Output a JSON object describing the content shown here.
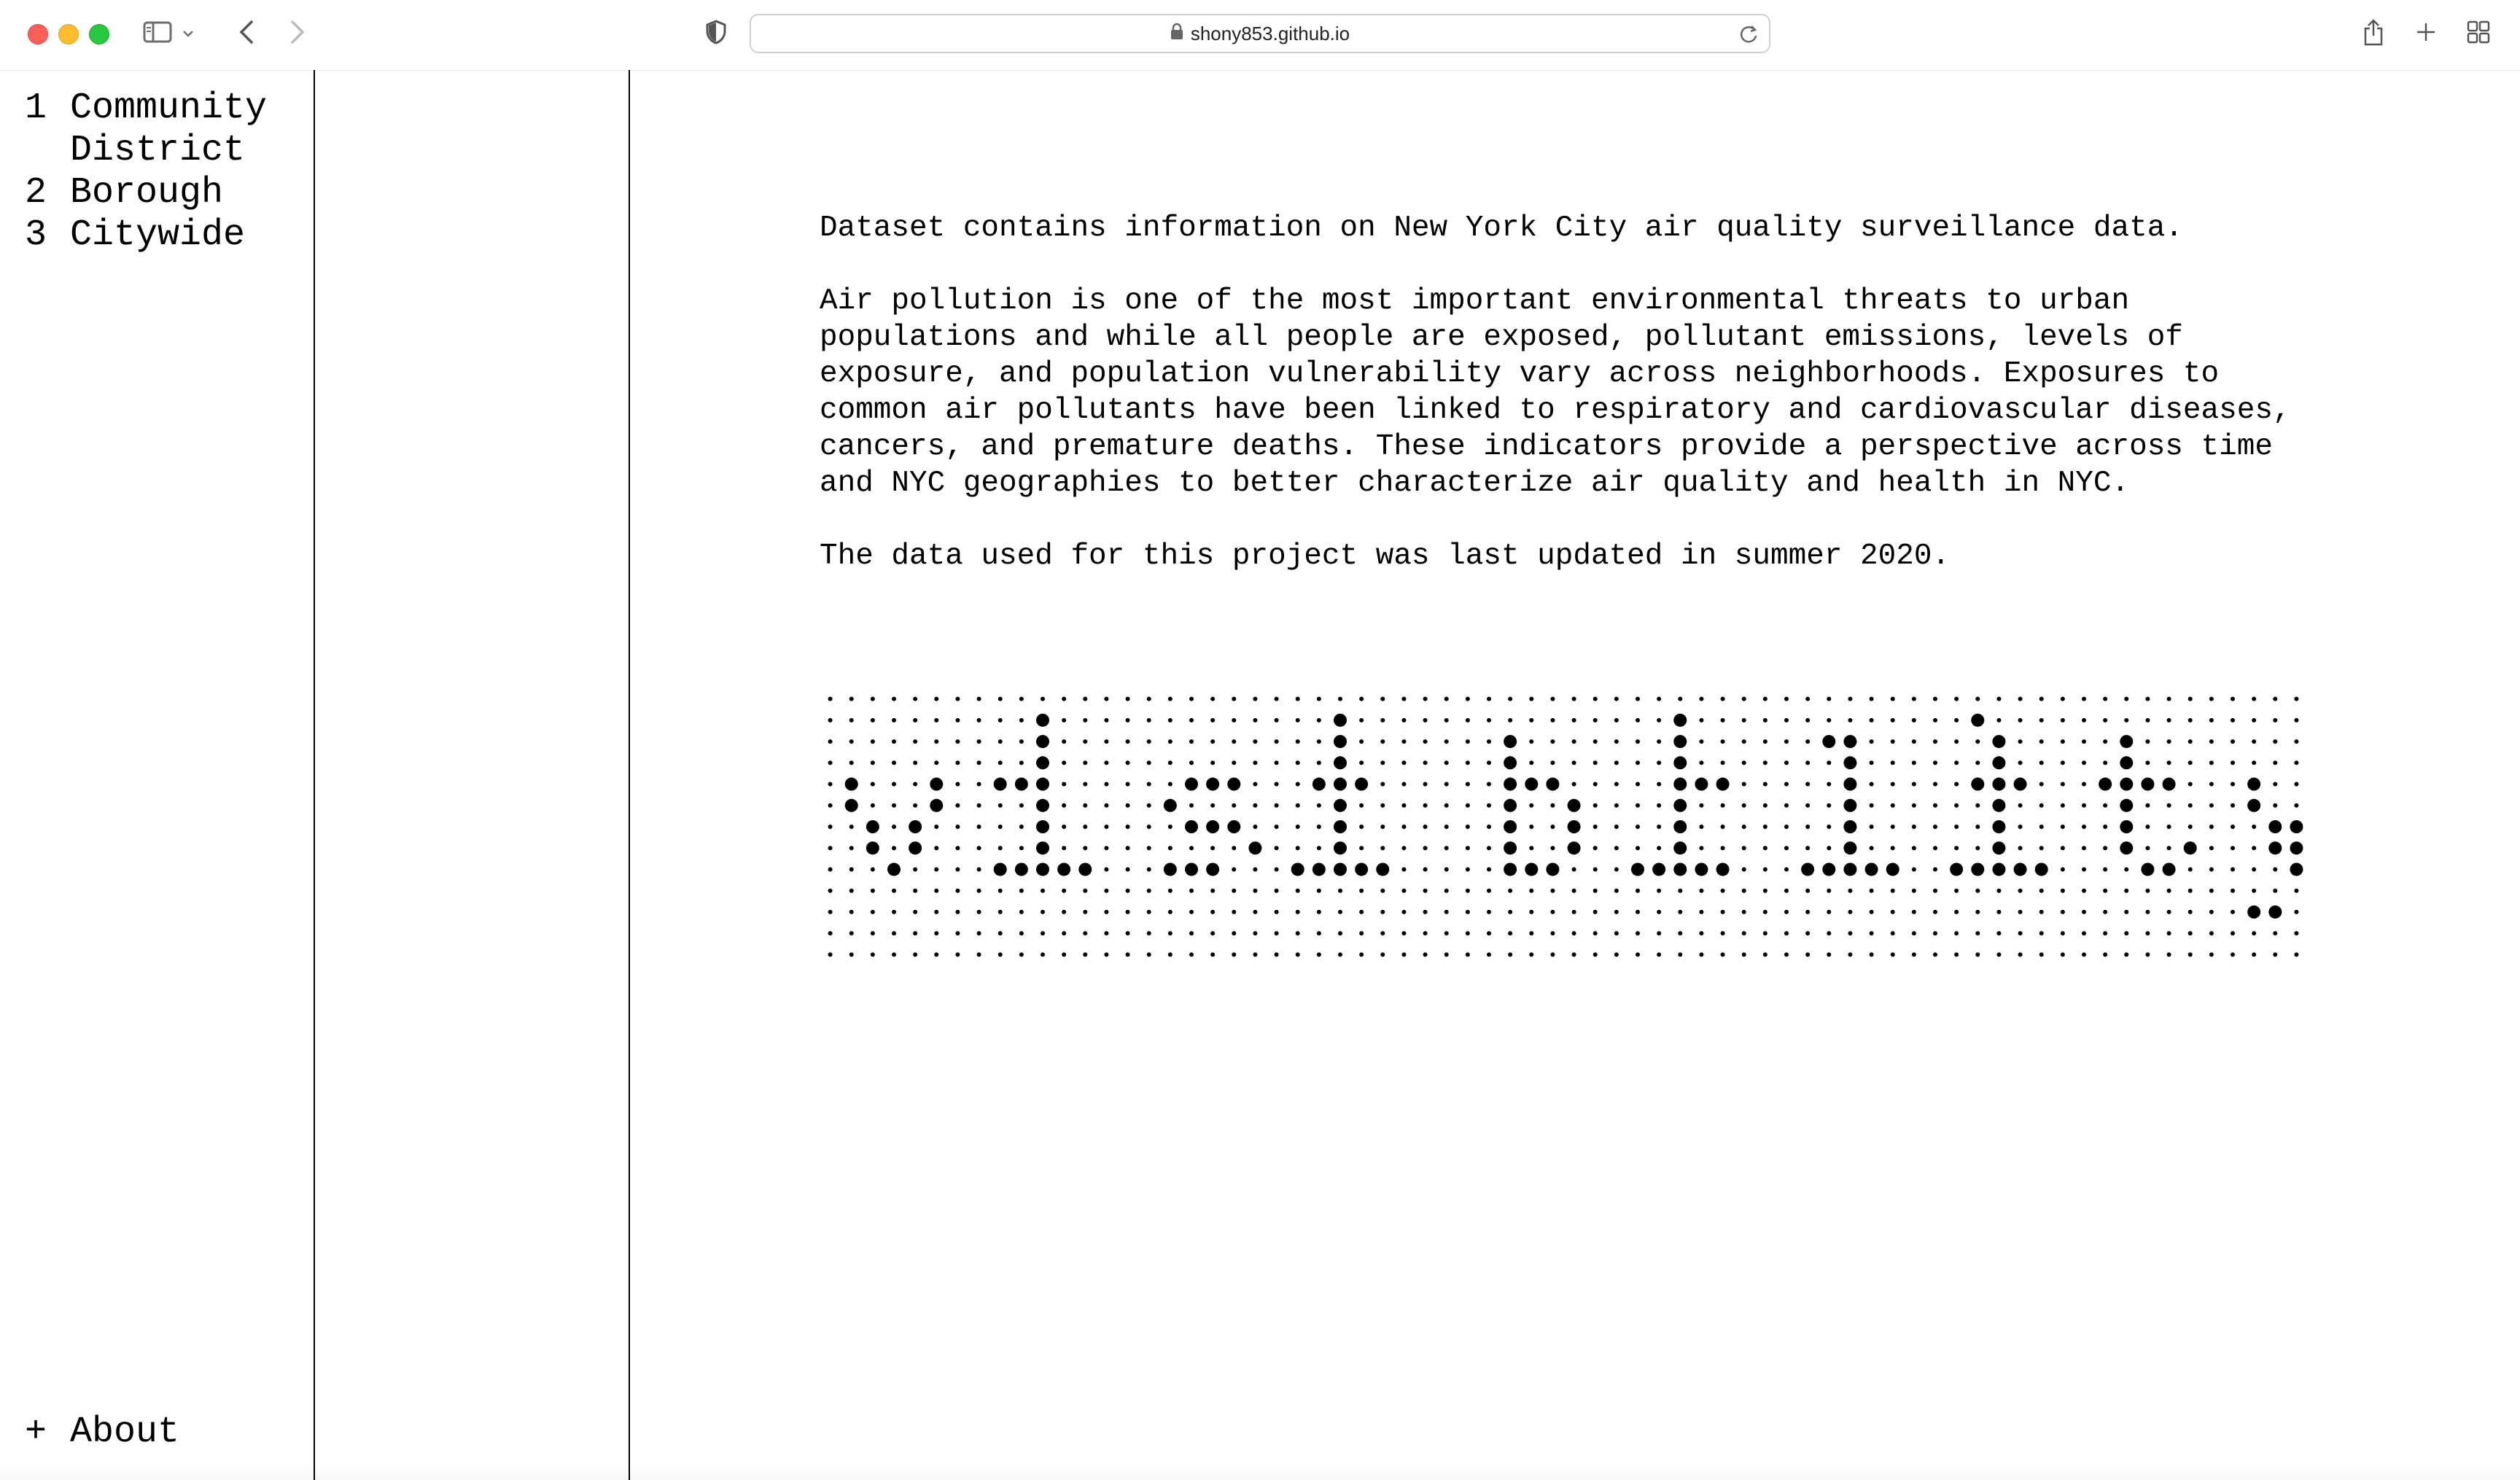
{
  "browser": {
    "url": "shony853.github.io",
    "icons": {
      "sidebar": "sidebar-icon",
      "back": "chevron-left-icon",
      "forward": "chevron-right-icon",
      "privacy": "shield-icon",
      "lock": "lock-icon",
      "reload": "reload-icon",
      "share": "share-icon",
      "new_tab": "plus-icon",
      "tabs": "tab-grid-icon"
    }
  },
  "sidebar": {
    "items": [
      {
        "num": "1",
        "label": "Community District"
      },
      {
        "num": "2",
        "label": "Borough"
      },
      {
        "num": "3",
        "label": "Citywide"
      }
    ],
    "about": {
      "symbol": "+",
      "label": "About"
    }
  },
  "main": {
    "paragraphs": [
      "Dataset contains information on New York City air quality surveillance data.",
      "Air pollution is one of the most important environmental threats to urban\npopulations and while all people are exposed, pollutant emissions, levels of\nexposure, and population vulnerability vary across neighborhoods. Exposures to\ncommon air pollutants have been linked to respiratory and cardiovascular diseases,\ncancers, and premature deaths. These indicators provide a perspective across time\nand NYC geographies to better characterize air quality and health in NYC.",
      "The data used for this project was last updated in summer 2020."
    ],
    "dot_matrix": {
      "cols": 70,
      "rows": 13,
      "large_dot_rows": [
        "..................................................................",
        "",
        "",
        "",
        "",
        "",
        "",
        "",
        "",
        "",
        "",
        "",
        ""
      ],
      "colors": {
        "dot": "#000000"
      }
    }
  },
  "colors": {
    "close": "#fe5f57",
    "minimize": "#febc2e",
    "zoom": "#28c840",
    "border": "#000000"
  }
}
